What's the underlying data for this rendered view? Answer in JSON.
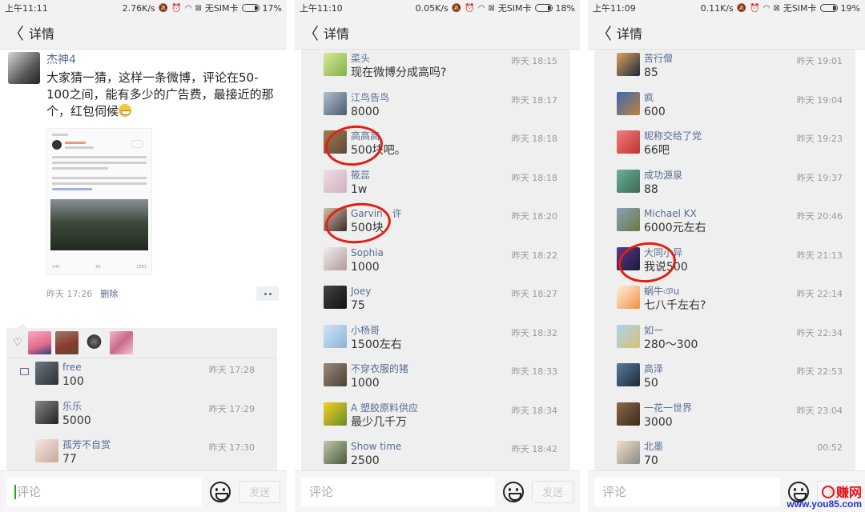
{
  "screens": [
    {
      "status": {
        "time": "上午11:11",
        "speed": "2.76K/s",
        "sim": "无SIM卡",
        "battery": "17%"
      },
      "nav": {
        "back_icon": "chevron-left-icon",
        "title": "详情"
      },
      "post": {
        "author": "杰神4",
        "text": "大家猜一猜，这样一条微博，评论在50-100之间，能有多少的广告费，最接近的那个，红包伺候",
        "emoji": "grin-emoji",
        "time": "昨天 17:26",
        "delete_label": "删除",
        "embedded_stats": [
          "140",
          "50",
          "1593"
        ]
      },
      "likes": {
        "icon": "heart-icon",
        "count": 4
      },
      "comments": [
        {
          "name": "free",
          "text": "100",
          "time": "昨天 17:28"
        },
        {
          "name": "乐乐",
          "text": "5000",
          "time": "昨天 17:29"
        },
        {
          "name": "孤芳不自赏",
          "text": "77",
          "time": "昨天 17:30"
        }
      ],
      "input": {
        "placeholder": "评论",
        "send_label": "发送"
      }
    },
    {
      "status": {
        "time": "上午11:10",
        "speed": "0.05K/s",
        "sim": "无SIM卡",
        "battery": "18%"
      },
      "nav": {
        "back_icon": "chevron-left-icon",
        "title": "详情"
      },
      "comments": [
        {
          "name": "菜头",
          "text": "现在微博分成高吗?",
          "time": "昨天 18:15"
        },
        {
          "name": "江鸟告鸟",
          "text": "8000",
          "time": "昨天 18:17"
        },
        {
          "name": "高高高",
          "text": "500块吧。",
          "time": "昨天 18:18",
          "circled": true
        },
        {
          "name": "筱蕊",
          "text": "1w",
          "time": "昨天 18:18"
        },
        {
          "name": "Garvin - 许",
          "text": "500块",
          "time": "昨天 18:20",
          "circled": true
        },
        {
          "name": "Sophia",
          "text": "1000",
          "time": "昨天 18:22"
        },
        {
          "name": "Joey",
          "text": "75",
          "time": "昨天 18:27"
        },
        {
          "name": "小杨哥",
          "text": "1500左右",
          "time": "昨天 18:32"
        },
        {
          "name": "不穿衣服的猪",
          "text": "1000",
          "time": "昨天 18:33"
        },
        {
          "name": "A 塑胶原料供应",
          "text": "最少几千万",
          "time": "昨天 18:34"
        },
        {
          "name": "Show time",
          "text": "2500",
          "time": "昨天 18:42"
        }
      ],
      "input": {
        "placeholder": "评论",
        "send_label": "发送"
      }
    },
    {
      "status": {
        "time": "上午11:09",
        "speed": "0.11K/s",
        "sim": "无SIM卡",
        "battery": "19%"
      },
      "nav": {
        "back_icon": "chevron-left-icon",
        "title": "详情"
      },
      "comments": [
        {
          "name": "苦行僧",
          "text": "85",
          "time": "昨天 19:01"
        },
        {
          "name": "疯",
          "text": "600",
          "time": "昨天 19:04"
        },
        {
          "name": "昵称交给了党",
          "text": "66吧",
          "time": "昨天 19:23"
        },
        {
          "name": "成功源泉",
          "text": "88",
          "time": "昨天 19:37"
        },
        {
          "name": "Michael KX",
          "text": "6000元左右",
          "time": "昨天 20:46"
        },
        {
          "name": "大同小异",
          "text": "我说500",
          "time": "昨天 21:13",
          "circled": true
        },
        {
          "name": "蜗牛ঞu",
          "text": "七八千左右?",
          "time": "昨天 22:14"
        },
        {
          "name": "如一",
          "text": "280～300",
          "time": "昨天 22:34"
        },
        {
          "name": "高泽",
          "text": "50",
          "time": "昨天 22:53"
        },
        {
          "name": "一花一世界",
          "text": "3000",
          "time": "昨天 23:04"
        },
        {
          "name": "北墨",
          "text": "70",
          "time": "00:52"
        }
      ],
      "input": {
        "placeholder": "评论",
        "send_label": "发送"
      }
    }
  ],
  "watermark": {
    "brand": "赚网",
    "url": "www.you85.com"
  },
  "colors": {
    "link": "#576b95",
    "annotation": "#e02010",
    "caret": "#1aad19"
  }
}
